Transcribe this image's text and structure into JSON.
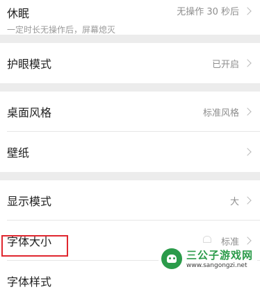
{
  "settings": {
    "sleep": {
      "title": "休眠",
      "subtitle": "一定时长无操作后，屏幕熄灭",
      "value": "无操作 30 秒后"
    },
    "eye_protection": {
      "title": "护眼模式",
      "value": "已开启"
    },
    "desktop_style": {
      "title": "桌面风格",
      "value": "标准风格"
    },
    "wallpaper": {
      "title": "壁纸",
      "value": ""
    },
    "display_mode": {
      "title": "显示模式",
      "value": "大"
    },
    "font_size": {
      "title": "字体大小",
      "value": "标准"
    },
    "font_style": {
      "title": "字体样式",
      "value": ""
    }
  },
  "watermark": {
    "name": "三公子游戏网",
    "url": "www.sangongzi.net",
    "logo_icon": "android-robot-icon"
  },
  "colors": {
    "highlight": "#e0262e",
    "watermark_green": "#2b9b4a"
  }
}
